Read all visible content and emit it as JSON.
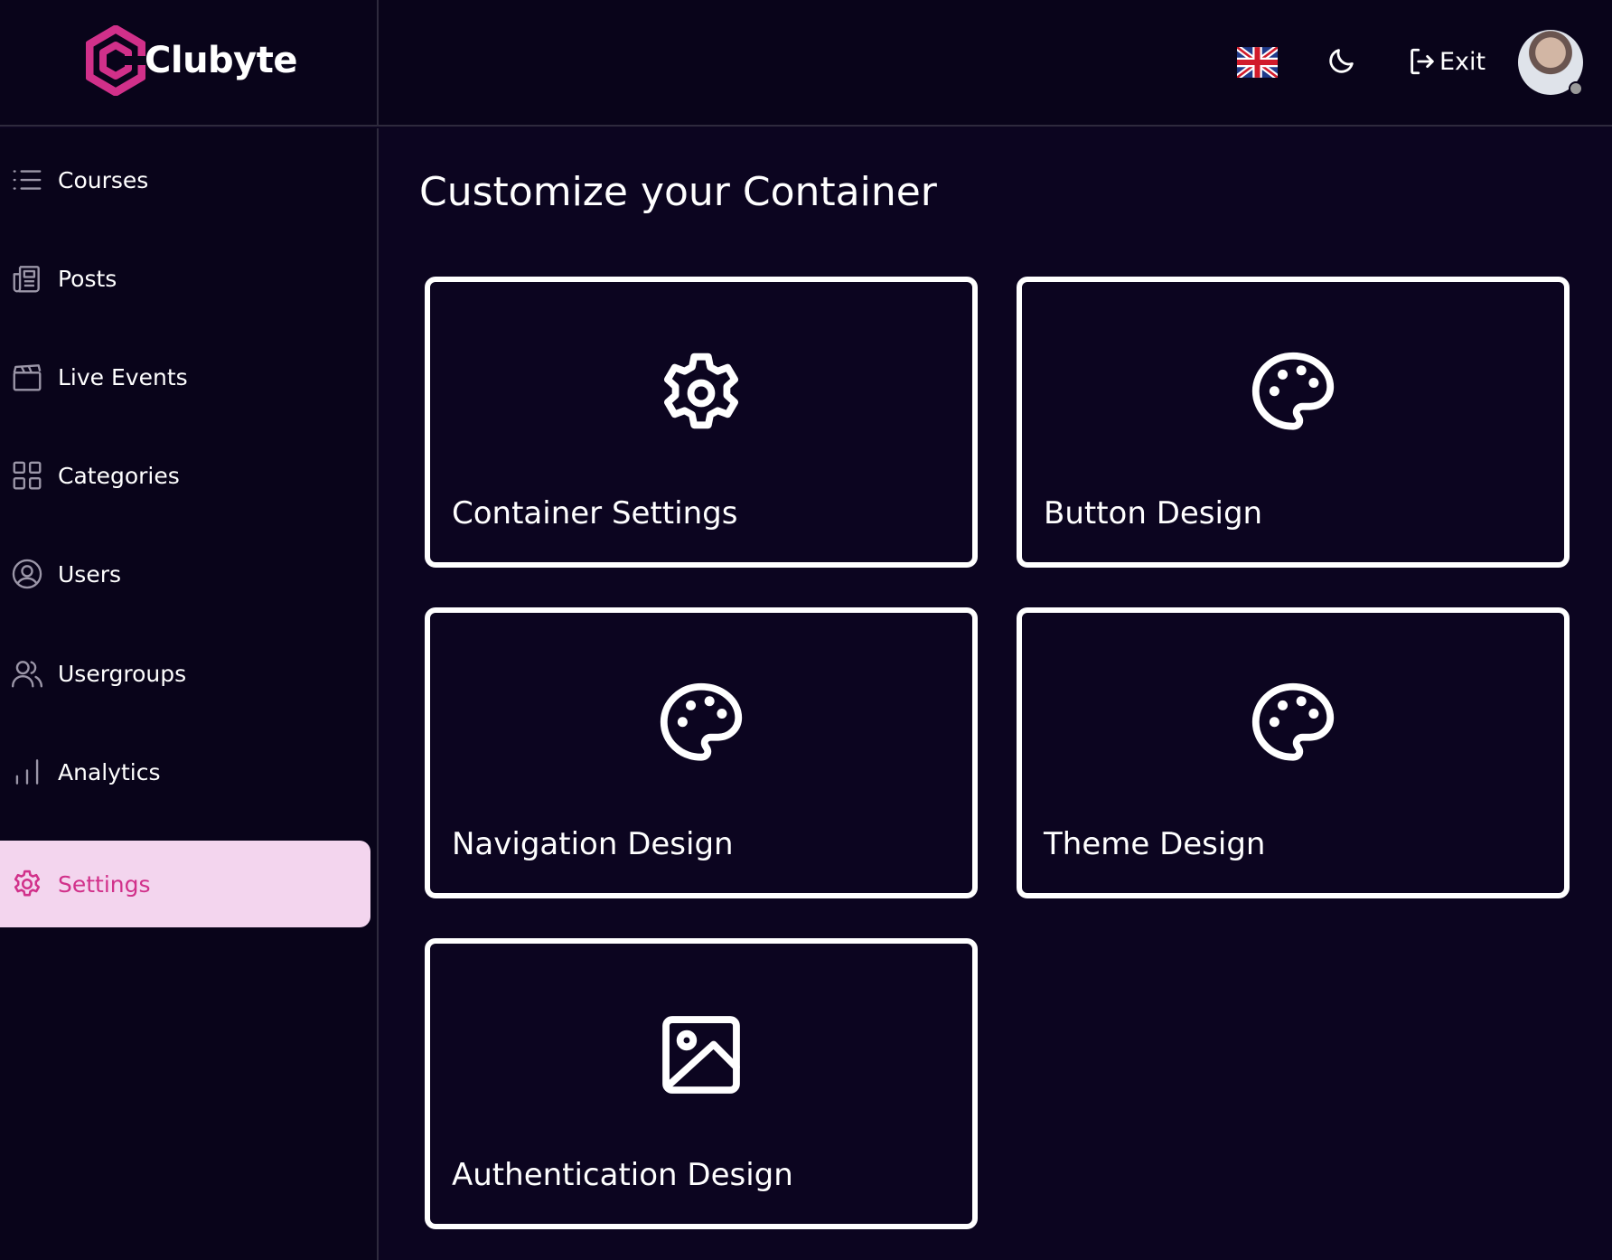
{
  "brand": {
    "name": "Clubyte",
    "accent": "#d1308a"
  },
  "topbar": {
    "language": "English (UK)",
    "exit_label": "Exit"
  },
  "sidebar": {
    "items": [
      {
        "label": "Courses",
        "icon": "list-icon"
      },
      {
        "label": "Posts",
        "icon": "newspaper-icon"
      },
      {
        "label": "Live Events",
        "icon": "clapperboard-icon"
      },
      {
        "label": "Categories",
        "icon": "grid-icon"
      },
      {
        "label": "Users",
        "icon": "user-circle-icon"
      },
      {
        "label": "Usergroups",
        "icon": "users-icon"
      },
      {
        "label": "Analytics",
        "icon": "bar-chart-icon"
      },
      {
        "label": "Settings",
        "icon": "gear-icon",
        "active": true
      }
    ]
  },
  "main": {
    "title": "Customize your Container",
    "cards": [
      {
        "label": "Container Settings",
        "icon": "gear-icon"
      },
      {
        "label": "Button Design",
        "icon": "palette-icon"
      },
      {
        "label": "Navigation Design",
        "icon": "palette-icon"
      },
      {
        "label": "Theme Design",
        "icon": "palette-icon"
      },
      {
        "label": "Authentication Design",
        "icon": "image-icon"
      }
    ]
  }
}
